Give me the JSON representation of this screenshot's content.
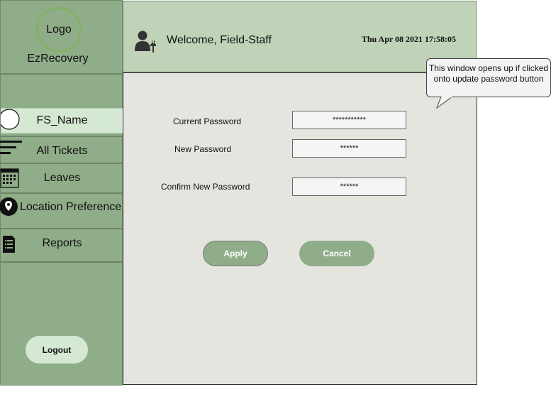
{
  "sidebar": {
    "logo_text": "Logo",
    "app_name": "EzRecovery",
    "items": [
      {
        "label": "FS_Name",
        "icon": "user-circle-icon"
      },
      {
        "label": "All Tickets",
        "icon": "list-lines-icon"
      },
      {
        "label": "Leaves",
        "icon": "calendar-icon"
      },
      {
        "label": "Location Preference",
        "icon": "location-pin-icon"
      },
      {
        "label": "Reports",
        "icon": "document-icon"
      }
    ],
    "logout_label": "Logout"
  },
  "header": {
    "user_icon": "field-staff-user-icon",
    "welcome_text": "Welcome, Field-Staff",
    "datetime": "Thu Apr 08 2021 17:58:05"
  },
  "form": {
    "current_password_label": "Current Password",
    "current_password_value": "***********",
    "new_password_label": "New Password",
    "new_password_value": "******",
    "confirm_password_label": "Confirm New Password",
    "confirm_password_value": "******",
    "apply_label": "Apply",
    "cancel_label": "Cancel"
  },
  "annotation": {
    "text": "This window opens up if clicked onto update password button"
  },
  "colors": {
    "sidebar": "#8fad88",
    "header": "#c0d2b8",
    "content": "#e4e5de",
    "active_item": "#d5e8d4",
    "button": "#8fad88"
  }
}
